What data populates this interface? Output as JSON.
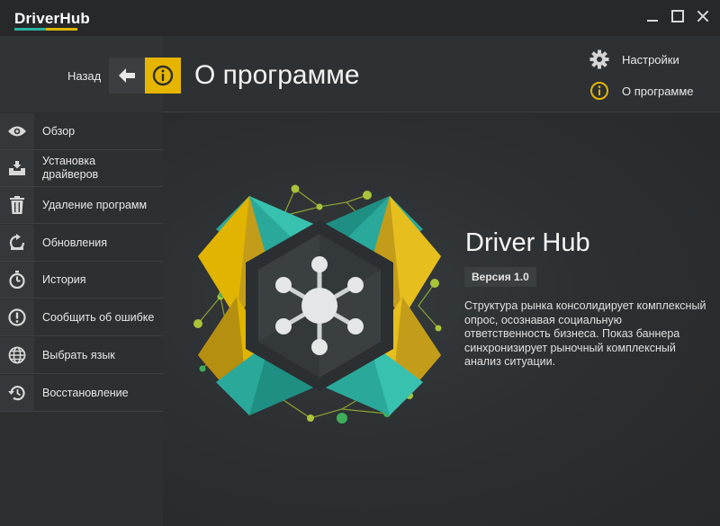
{
  "app": {
    "logo_text": "DriverHub"
  },
  "header": {
    "back_label": "Назад",
    "title": "О программе"
  },
  "top_menu": {
    "settings_label": "Настройки",
    "about_label": "О программе"
  },
  "sidebar": {
    "items": [
      {
        "label": "Обзор",
        "icon": "eye-icon"
      },
      {
        "label": "Установка драйверов",
        "icon": "install-tray-icon"
      },
      {
        "label": "Удаление программ",
        "icon": "trash-icon"
      },
      {
        "label": "Обновления",
        "icon": "update-icon"
      },
      {
        "label": "История",
        "icon": "stopwatch-icon"
      },
      {
        "label": "Сообщить об ошибке",
        "icon": "alert-icon"
      },
      {
        "label": "Выбрать язык",
        "icon": "globe-icon"
      },
      {
        "label": "Восстановление",
        "icon": "restore-icon"
      }
    ]
  },
  "about": {
    "product_name": "Driver Hub",
    "version": "Версия 1.0",
    "description": "Структура рынка консолидирует комплексный опрос, осознавая социальную ответственность бизнеса. Показ баннера синхронизирует рыночный комплексный анализ ситуации."
  },
  "colors": {
    "accent_yellow": "#e6b500",
    "accent_teal": "#2ab3a0",
    "background": "#2b2e30",
    "sidebar": "#2c3031"
  }
}
